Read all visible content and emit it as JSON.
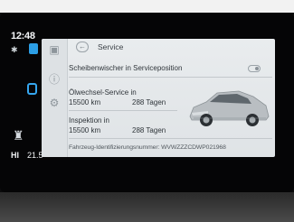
{
  "status": {
    "time": "12:48",
    "bluetooth": "✱",
    "climate_label": "HI",
    "climate_value": "21.5"
  },
  "screen": {
    "title": "Service",
    "wiper": {
      "label": "Scheibenwischer in Serviceposition"
    },
    "oil": {
      "label": "Ölwechsel-Service in",
      "km": "15500 km",
      "days": "288 Tagen"
    },
    "inspection": {
      "label": "Inspektion in",
      "km": "15500 km",
      "days": "288 Tagen"
    },
    "vin": "Fahrzeug-Identifizierungsnummer: WVWZZZCDWP021968"
  },
  "colors": {
    "accent": "#2c9fe6",
    "screen_bg": "#e4e8ea"
  }
}
